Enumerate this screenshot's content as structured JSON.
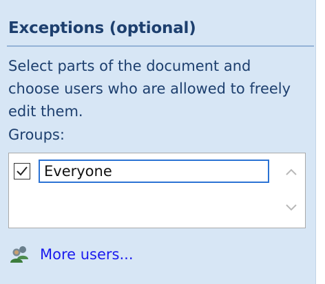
{
  "section": {
    "title": "Exceptions (optional)",
    "description": "Select parts of the document and choose users who are allowed to freely edit them."
  },
  "groups": {
    "label": "Groups:",
    "items": [
      {
        "name": "Everyone",
        "checked": true
      }
    ]
  },
  "actions": {
    "more_users_label": "More users..."
  },
  "icons": {
    "checkbox": "checkmark-icon",
    "scroll_up": "chevron-up-icon",
    "scroll_down": "chevron-down-icon",
    "users": "users-icon"
  },
  "colors": {
    "panel_background": "#d7e6f5",
    "title_text": "#1d3f6e",
    "link": "#1a1aee",
    "selection_border": "#2a72d4"
  }
}
